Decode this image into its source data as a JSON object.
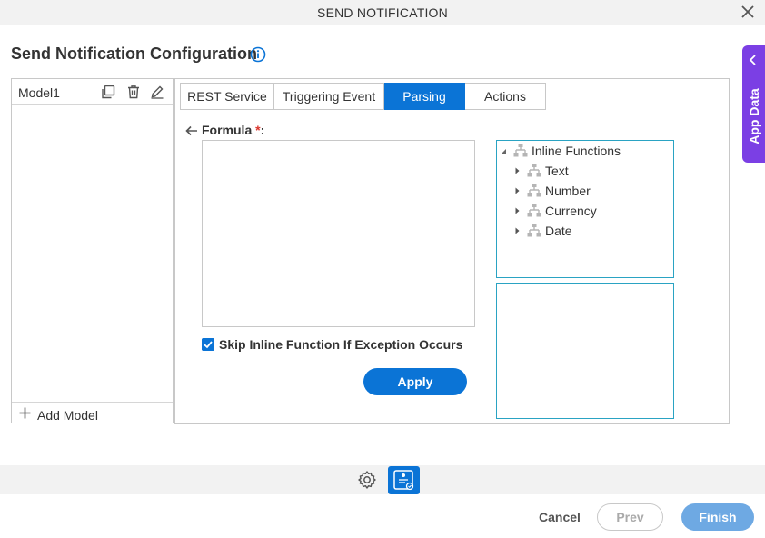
{
  "window": {
    "title": "SEND NOTIFICATION",
    "close_icon": "close-icon"
  },
  "page": {
    "title": "Send Notification Configuration",
    "info_icon": "info-icon"
  },
  "app_data_tab": {
    "label": "App Data",
    "icon": "chevron-left-icon",
    "accent": "#7b3fe4"
  },
  "model_panel": {
    "models": [
      {
        "name": "Model1"
      }
    ],
    "add_model_label": "Add Model"
  },
  "tabs": [
    {
      "label": "REST Service",
      "active": false
    },
    {
      "label": "Triggering Event",
      "active": false
    },
    {
      "label": "Parsing",
      "active": true
    },
    {
      "label": "Actions",
      "active": false
    }
  ],
  "formula": {
    "label": "Formula",
    "required_marker": "*",
    "suffix": ":",
    "value": ""
  },
  "skip_inline": {
    "label": "Skip Inline Function If Exception Occurs",
    "checked": true
  },
  "apply_label": "Apply",
  "tree": {
    "root": {
      "label": "Inline Functions",
      "expanded": true
    },
    "children": [
      {
        "label": "Text",
        "expanded": false
      },
      {
        "label": "Number",
        "expanded": false
      },
      {
        "label": "Currency",
        "expanded": false
      },
      {
        "label": "Date",
        "expanded": false
      }
    ]
  },
  "footer": {
    "cancel_label": "Cancel",
    "prev_label": "Prev",
    "finish_label": "Finish"
  },
  "colors": {
    "primary": "#0b74d6",
    "tree_border": "#2aa3c3",
    "finish_disabled": "#6ea9e3"
  }
}
